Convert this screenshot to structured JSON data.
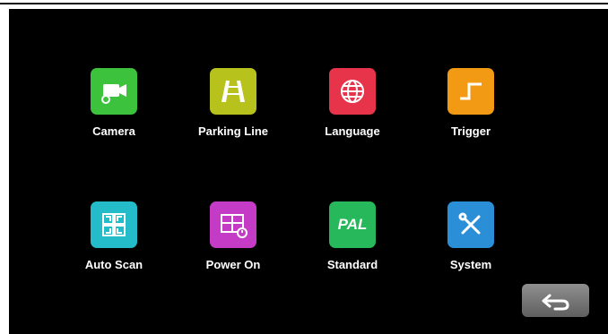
{
  "menu": {
    "items": [
      {
        "label": "Camera",
        "icon": "camera-icon",
        "color": "#3cc23c"
      },
      {
        "label": "Parking Line",
        "icon": "parking-line-icon",
        "color": "#b8c21c"
      },
      {
        "label": "Language",
        "icon": "globe-icon",
        "color": "#e8344a"
      },
      {
        "label": "Trigger",
        "icon": "trigger-icon",
        "color": "#f29a14"
      },
      {
        "label": "Auto Scan",
        "icon": "auto-scan-icon",
        "color": "#23bcc8"
      },
      {
        "label": "Power On",
        "icon": "power-on-icon",
        "color": "#c43cc6"
      },
      {
        "label": "Standard",
        "icon": "standard-icon",
        "color": "#26b85a",
        "icon_text": "PAL"
      },
      {
        "label": "System",
        "icon": "system-icon",
        "color": "#2a8fd6"
      }
    ]
  },
  "back_button": {
    "icon": "back-arrow-icon"
  },
  "colors": {
    "background": "#000000",
    "label": "#ffffff"
  }
}
